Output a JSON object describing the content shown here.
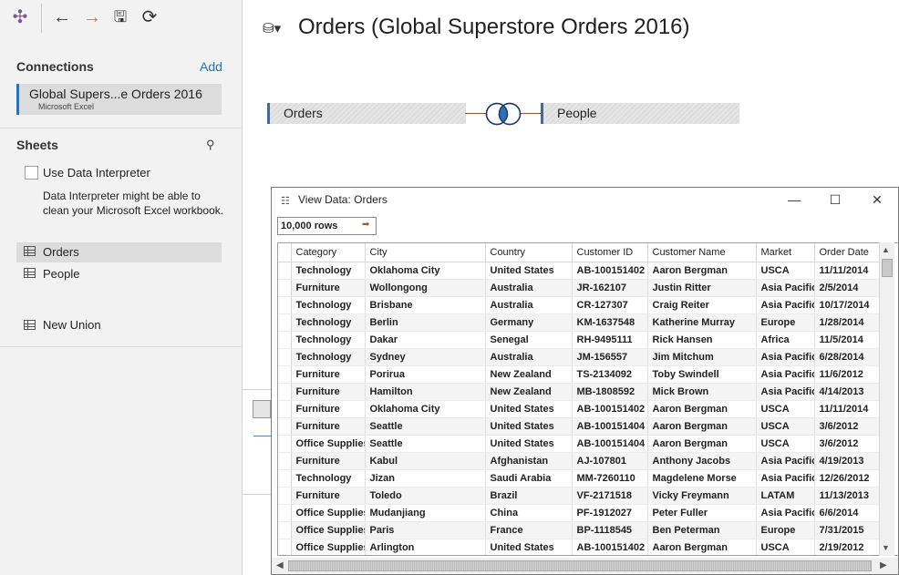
{
  "toolbar": {
    "items": [
      {
        "name": "tableau-logo-icon",
        "glyph": "✣"
      },
      {
        "name": "back-arrow-icon",
        "glyph": "←"
      },
      {
        "name": "forward-arrow-icon",
        "glyph": "→"
      },
      {
        "name": "save-icon",
        "glyph": "🖫"
      },
      {
        "name": "refresh-icon",
        "glyph": "⟳"
      }
    ]
  },
  "connections": {
    "heading": "Connections",
    "add_label": "Add",
    "item": {
      "name": "Global Supers...e Orders 2016",
      "type": "Microsoft Excel"
    }
  },
  "sheets": {
    "heading": "Sheets",
    "interpreter_label": "Use Data Interpreter",
    "interpreter_desc": "Data Interpreter might be able to clean your Microsoft Excel workbook.",
    "items": [
      {
        "label": "Orders",
        "selected": true
      },
      {
        "label": "People",
        "selected": false
      }
    ],
    "new_union": "New Union"
  },
  "canvas": {
    "title": "Orders (Global Superstore Orders 2016)",
    "left_table": "Orders",
    "right_table": "People",
    "accent_color": "#2f6fb3"
  },
  "view_data": {
    "title": "View Data:  Orders",
    "window_buttons": {
      "minimize": "—",
      "maximize": "☐",
      "close": "✕"
    },
    "rows_label": "10,000 rows",
    "columns": [
      "Category",
      "City",
      "Country",
      "Customer ID",
      "Customer Name",
      "Market",
      "Order Date"
    ],
    "rows": [
      [
        "Technology",
        "Oklahoma City",
        "United States",
        "AB-100151402",
        "Aaron Bergman",
        "USCA",
        "11/11/2014"
      ],
      [
        "Furniture",
        "Wollongong",
        "Australia",
        "JR-162107",
        "Justin Ritter",
        "Asia Pacific",
        "2/5/2014"
      ],
      [
        "Technology",
        "Brisbane",
        "Australia",
        "CR-127307",
        "Craig Reiter",
        "Asia Pacific",
        "10/17/2014"
      ],
      [
        "Technology",
        "Berlin",
        "Germany",
        "KM-1637548",
        "Katherine Murray",
        "Europe",
        "1/28/2014"
      ],
      [
        "Technology",
        "Dakar",
        "Senegal",
        "RH-9495111",
        "Rick Hansen",
        "Africa",
        "11/5/2014"
      ],
      [
        "Technology",
        "Sydney",
        "Australia",
        "JM-156557",
        "Jim Mitchum",
        "Asia Pacific",
        "6/28/2014"
      ],
      [
        "Furniture",
        "Porirua",
        "New Zealand",
        "TS-2134092",
        "Toby Swindell",
        "Asia Pacific",
        "11/6/2012"
      ],
      [
        "Furniture",
        "Hamilton",
        "New Zealand",
        "MB-1808592",
        "Mick Brown",
        "Asia Pacific",
        "4/14/2013"
      ],
      [
        "Furniture",
        "Oklahoma City",
        "United States",
        "AB-100151402",
        "Aaron Bergman",
        "USCA",
        "11/11/2014"
      ],
      [
        "Furniture",
        "Seattle",
        "United States",
        "AB-100151404",
        "Aaron Bergman",
        "USCA",
        "3/6/2012"
      ],
      [
        "Office Supplies",
        "Seattle",
        "United States",
        "AB-100151404",
        "Aaron Bergman",
        "USCA",
        "3/6/2012"
      ],
      [
        "Furniture",
        "Kabul",
        "Afghanistan",
        "AJ-107801",
        "Anthony Jacobs",
        "Asia Pacific",
        "4/19/2013"
      ],
      [
        "Technology",
        "Jizan",
        "Saudi Arabia",
        "MM-7260110",
        "Magdelene Morse",
        "Asia Pacific",
        "12/26/2012"
      ],
      [
        "Furniture",
        "Toledo",
        "Brazil",
        "VF-2171518",
        "Vicky Freymann",
        "LATAM",
        "11/13/2013"
      ],
      [
        "Office Supplies",
        "Mudanjiang",
        "China",
        "PF-1912027",
        "Peter Fuller",
        "Asia Pacific",
        "6/6/2014"
      ],
      [
        "Office Supplies",
        "Paris",
        "France",
        "BP-1118545",
        "Ben Peterman",
        "Europe",
        "7/31/2015"
      ],
      [
        "Office Supplies",
        "Arlington",
        "United States",
        "AB-100151402",
        "Aaron Bergman",
        "USCA",
        "2/19/2012"
      ]
    ]
  }
}
